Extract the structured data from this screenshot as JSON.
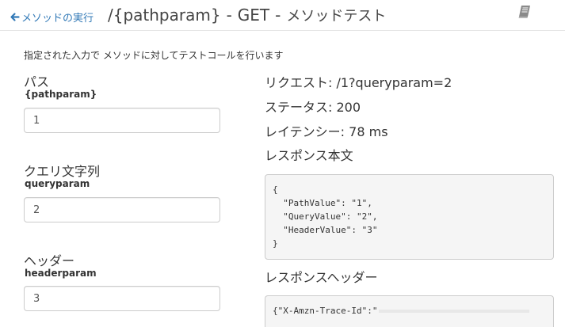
{
  "header": {
    "back_label": "メソッドの実行",
    "resource": "/{pathparam}",
    "method": "GET",
    "separator": "-",
    "subtitle": "メソッドテスト"
  },
  "description": "指定された入力で メソッドに対してテストコールを行います",
  "params": {
    "path": {
      "section_label": "パス",
      "name": "{pathparam}",
      "value": "1"
    },
    "query": {
      "section_label": "クエリ文字列",
      "name": "queryparam",
      "value": "2"
    },
    "headers": {
      "section_label": "ヘッダー",
      "name": "headerparam",
      "value": "3"
    }
  },
  "result": {
    "request_label": "リクエスト: /1?queryparam=2",
    "status_label": "ステータス: 200",
    "latency_label": "レイテンシー: 78 ms",
    "body_title": "レスポンス本文",
    "body_lines": [
      "{",
      "  \"PathValue\": \"1\",",
      "  \"QueryValue\": \"2\",",
      "  \"HeaderValue\": \"3\"",
      "}"
    ],
    "headers_title": "レスポンスヘッダー",
    "headers_first_line": "{\"X-Amzn-Trace-Id\":\""
  },
  "icons": {
    "back": "arrow-left-icon",
    "docs": "book-icon"
  },
  "colors": {
    "link": "#337ab7",
    "code_bg": "#f5f5f5",
    "border": "#cccccc"
  }
}
